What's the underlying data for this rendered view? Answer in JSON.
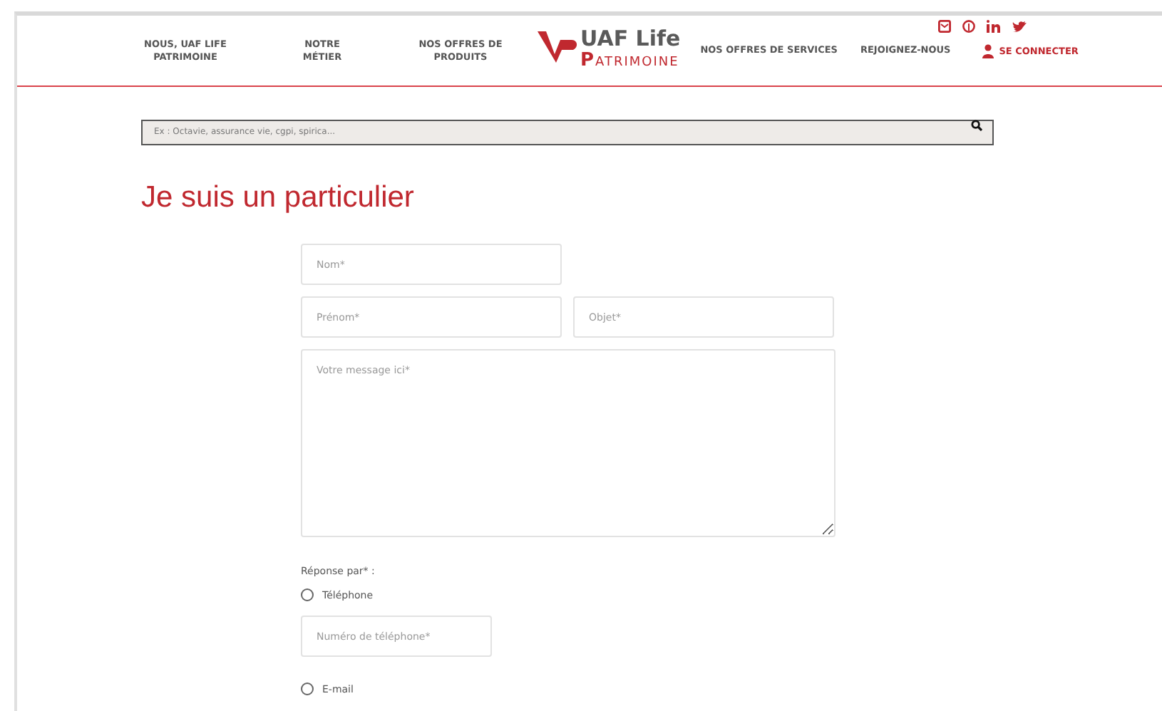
{
  "nav": {
    "left": [
      "NOUS, UAF LIFE PATRIMOINE",
      "NOTRE MÉTIER",
      "NOS OFFRES DE PRODUITS"
    ],
    "logo": {
      "name": "UAF Life",
      "initial": "P",
      "rest": "ATRIMOINE"
    },
    "right": [
      "NOS OFFRES DE SERVICES",
      "REJOIGNEZ-NOUS"
    ],
    "login": "SE CONNECTER"
  },
  "search": {
    "placeholder": "Ex : Octavie, assurance vie, cgpi, spirica..."
  },
  "title": "Je suis un particulier",
  "form": {
    "nom": {
      "placeholder": "Nom*"
    },
    "prenom": {
      "placeholder": "Prénom*"
    },
    "objet": {
      "placeholder": "Objet*"
    },
    "message": {
      "placeholder": "Votre message ici*"
    },
    "reply_label": "Réponse par* :",
    "options": [
      {
        "label": "Téléphone",
        "selected": false,
        "field": {
          "placeholder": "Numéro de téléphone*"
        }
      },
      {
        "label": "E-mail",
        "selected": false
      }
    ]
  }
}
